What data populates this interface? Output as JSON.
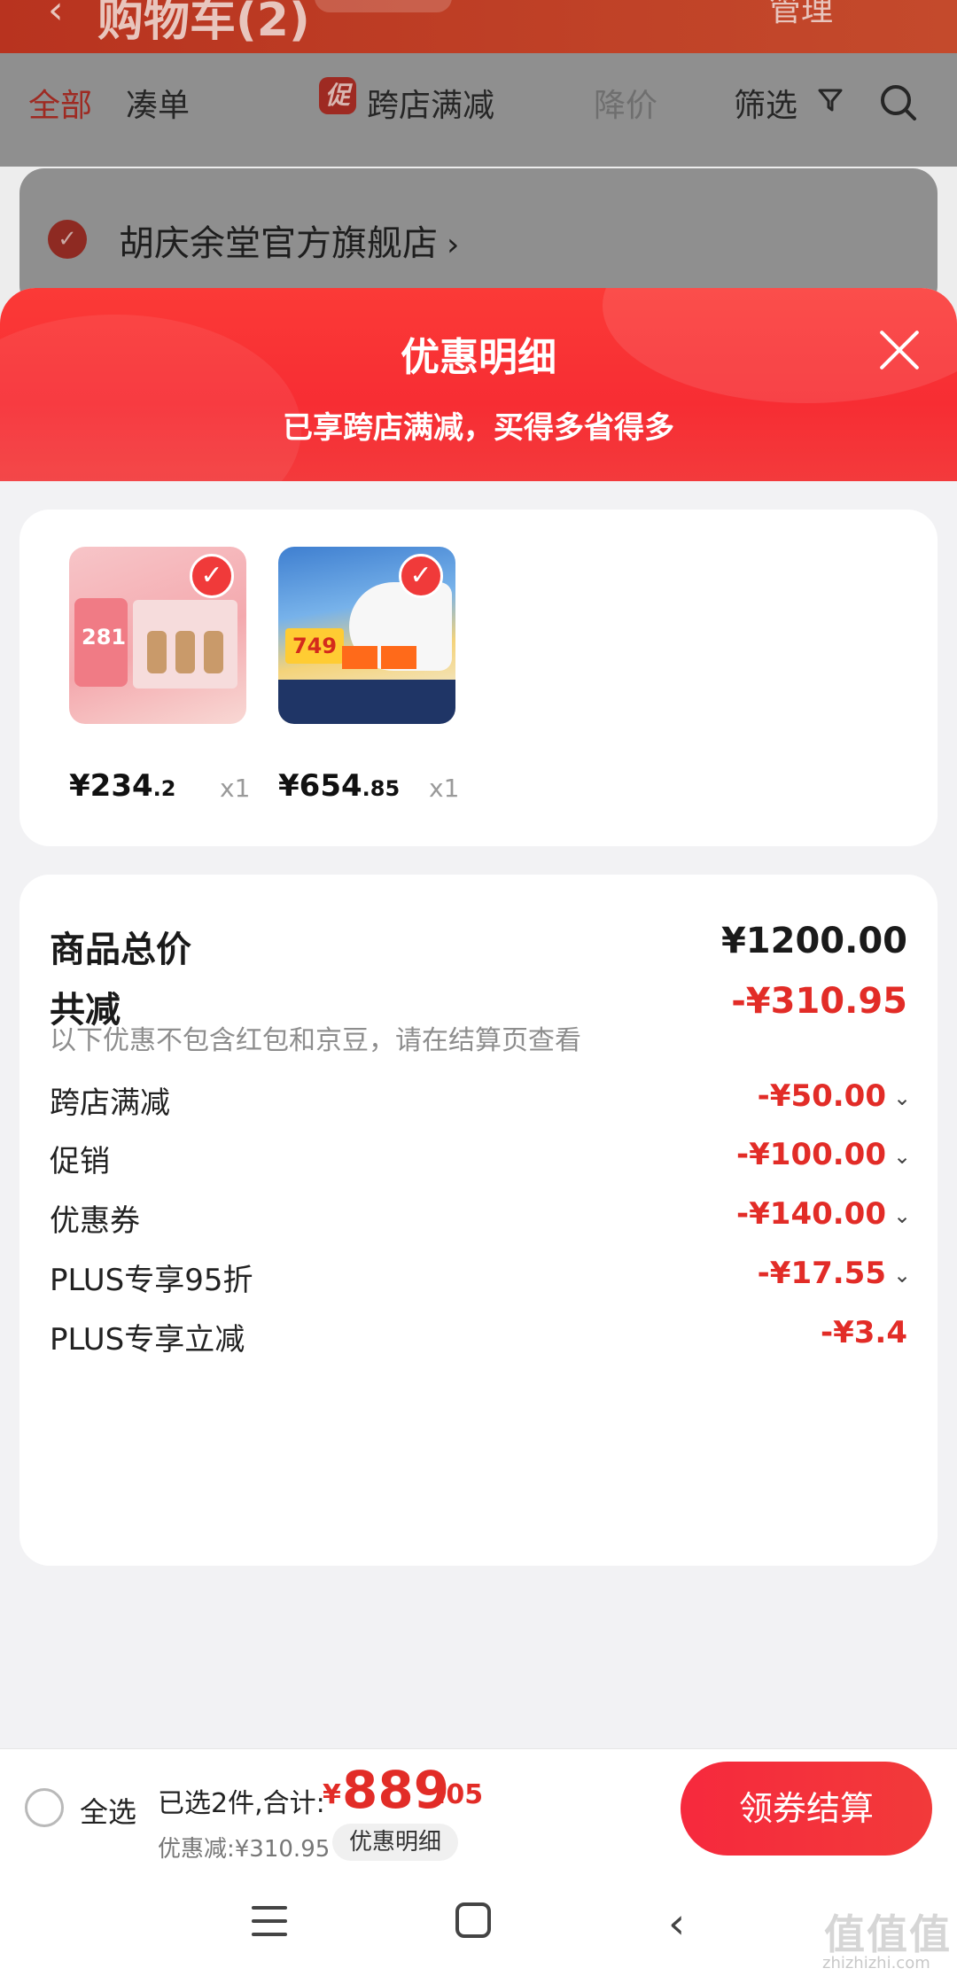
{
  "background": {
    "topbar": {
      "back_icon": "‹",
      "title": "购物车(2)",
      "manage": "管理"
    },
    "tabs": [
      "全部",
      "凑单",
      "跨店满减",
      "降价",
      "筛选"
    ],
    "promo_badge": "促",
    "store": {
      "name": "胡庆余堂官方旗舰店",
      "chevron": "›"
    }
  },
  "sheet": {
    "title": "优惠明细",
    "subtitle": "已享跨店满减，买得多省得多",
    "products": [
      {
        "price_main": "¥234",
        "price_cents": ".2",
        "qty": "x1",
        "thumb_text": "281"
      },
      {
        "price_main": "¥654",
        "price_cents": ".85",
        "qty": "x1",
        "thumb_text": "749"
      }
    ],
    "summary": {
      "total_label": "商品总价",
      "total_value": "¥1200.00",
      "reduce_label": "共减",
      "reduce_value": "-¥310.95",
      "note": "以下优惠不包含红包和京豆，请在结算页查看",
      "items": [
        {
          "label": "跨店满减",
          "value": "-¥50.00",
          "expandable": true
        },
        {
          "label": "促销",
          "value": "-¥100.00",
          "expandable": true
        },
        {
          "label": "优惠券",
          "value": "-¥140.00",
          "expandable": true
        },
        {
          "label": "PLUS专享95折",
          "value": "-¥17.55",
          "expandable": true
        },
        {
          "label": "PLUS专享立减",
          "value": "-¥3.4",
          "expandable": false
        }
      ]
    }
  },
  "bottom": {
    "select_all": "全选",
    "selected_text": "已选2件,合计:",
    "sum_yen": "¥",
    "sum_int": "889",
    "sum_dec": ".05",
    "discount_text": "优惠减:¥310.95",
    "detail_button": "优惠明细",
    "checkout_button": "领券结算"
  },
  "watermark": {
    "mark": "值值值",
    "site": "zhizhizhi.com"
  },
  "colors": {
    "accent": "#e22c27",
    "header_red": "#f72d33"
  }
}
